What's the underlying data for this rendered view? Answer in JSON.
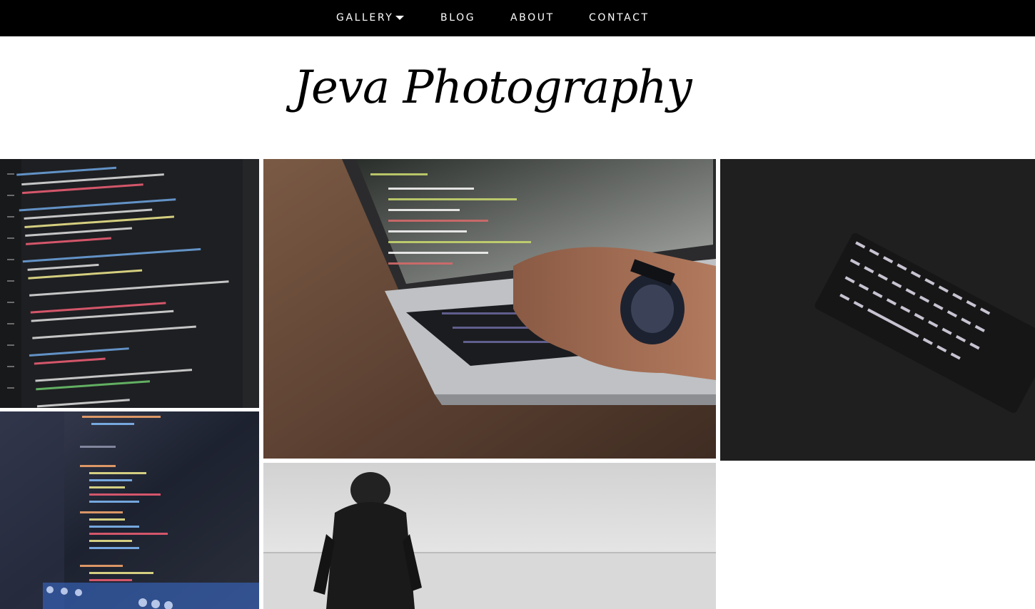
{
  "nav": {
    "items": [
      {
        "label": "GALLERY",
        "has_dropdown": true
      },
      {
        "label": "BLOG"
      },
      {
        "label": "ABOUT"
      },
      {
        "label": "CONTACT"
      }
    ]
  },
  "site": {
    "title": "Jeva Photography"
  },
  "gallery": {
    "photos": [
      {
        "subject": "code-editor-screen"
      },
      {
        "subject": "laptop-typing-hand-watch"
      },
      {
        "subject": "backlit-keyboard"
      },
      {
        "subject": "css-code-monitor"
      },
      {
        "subject": "person-by-sea-bw"
      }
    ]
  },
  "colors": {
    "nav_background": "#000000",
    "nav_text": "#ffffff",
    "page_background": "#ffffff",
    "title_text": "#000000"
  }
}
